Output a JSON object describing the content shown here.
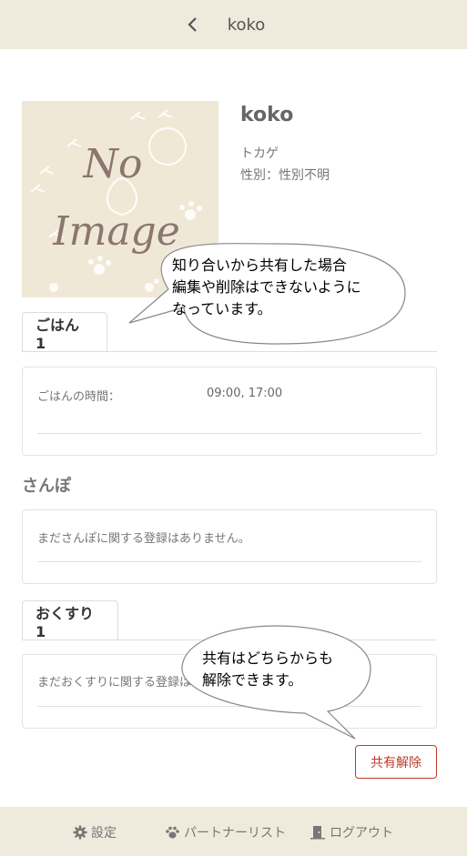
{
  "header": {
    "title": "koko"
  },
  "photo": {
    "placeholder_line1": "No",
    "placeholder_line2": "Image"
  },
  "pet": {
    "name": "koko",
    "species": "トカゲ",
    "sex": "性別：性別不明"
  },
  "meal_tab": {
    "label": "ごはん 1"
  },
  "meal_card": {
    "label": "ごはんの時間：",
    "value": "09:00, 17:00"
  },
  "walk_section": {
    "title": "さんぽ",
    "empty_text": "まださんぽに関する登録はありません。"
  },
  "medicine_tab": {
    "label": "おくすり 1"
  },
  "medicine_card": {
    "text": "まだおくすりに関する登録はあ"
  },
  "unshare_button": {
    "label": "共有解除",
    "color": "#c0392b"
  },
  "bubbles": {
    "top": {
      "line1": "知り合いから共有した場合",
      "line2": "編集や削除はできないように",
      "line3": "なっています。"
    },
    "bottom": {
      "line1": "共有はどちらからも",
      "line2": "解除できます。"
    }
  },
  "footer": {
    "settings": {
      "label": "設定",
      "icon": "gear-icon"
    },
    "partners": {
      "label": "パートナーリスト",
      "icon": "paw-icon"
    },
    "logout": {
      "label": "ログアウト",
      "icon": "door-icon"
    }
  },
  "colors": {
    "bar_bg": "#efeadb",
    "photo_bg": "#efe8d6"
  }
}
